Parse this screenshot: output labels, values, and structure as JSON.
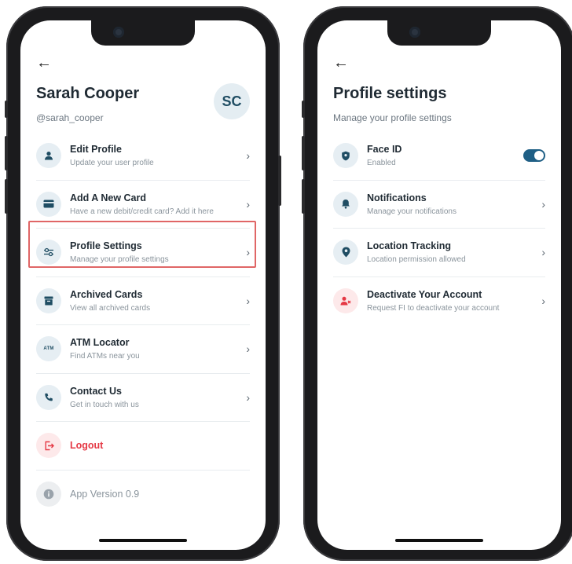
{
  "profile_screen": {
    "back_icon": "arrow-left-icon",
    "user_name": "Sarah Cooper",
    "user_handle": "@sarah_cooper",
    "avatar_initials": "SC",
    "menu": [
      {
        "icon": "user-icon",
        "title": "Edit Profile",
        "subtitle": "Update your user profile"
      },
      {
        "icon": "credit-card-icon",
        "title": "Add A New Card",
        "subtitle": "Have a new debit/credit card? Add it here"
      },
      {
        "icon": "sliders-icon",
        "title": "Profile Settings",
        "subtitle": "Manage your profile settings"
      },
      {
        "icon": "archive-icon",
        "title": "Archived Cards",
        "subtitle": "View all archived cards"
      },
      {
        "icon": "atm-icon",
        "title": "ATM Locator",
        "subtitle": "Find ATMs near you",
        "icon_text": "ATM"
      },
      {
        "icon": "phone-icon",
        "title": "Contact Us",
        "subtitle": "Get in touch with us"
      }
    ],
    "logout_label": "Logout",
    "app_version_label": "App Version 0.9",
    "highlight_color": "#e06666"
  },
  "settings_screen": {
    "back_icon": "arrow-left-icon",
    "title": "Profile settings",
    "subtitle": "Manage your profile settings",
    "items": [
      {
        "icon": "shield-icon",
        "title": "Face ID",
        "subtitle": "Enabled",
        "control": "toggle",
        "toggle_on": true
      },
      {
        "icon": "bell-icon",
        "title": "Notifications",
        "subtitle": "Manage your notifications",
        "control": "chevron"
      },
      {
        "icon": "location-pin-icon",
        "title": "Location Tracking",
        "subtitle": "Location permission allowed",
        "control": "chevron"
      },
      {
        "icon": "user-remove-icon",
        "title": "Deactivate Your Account",
        "subtitle": "Request FI to deactivate your account",
        "control": "chevron"
      }
    ]
  },
  "colors": {
    "accent": "#1f5f85",
    "danger": "#e53945",
    "icon_bg": "#e6eef3"
  }
}
